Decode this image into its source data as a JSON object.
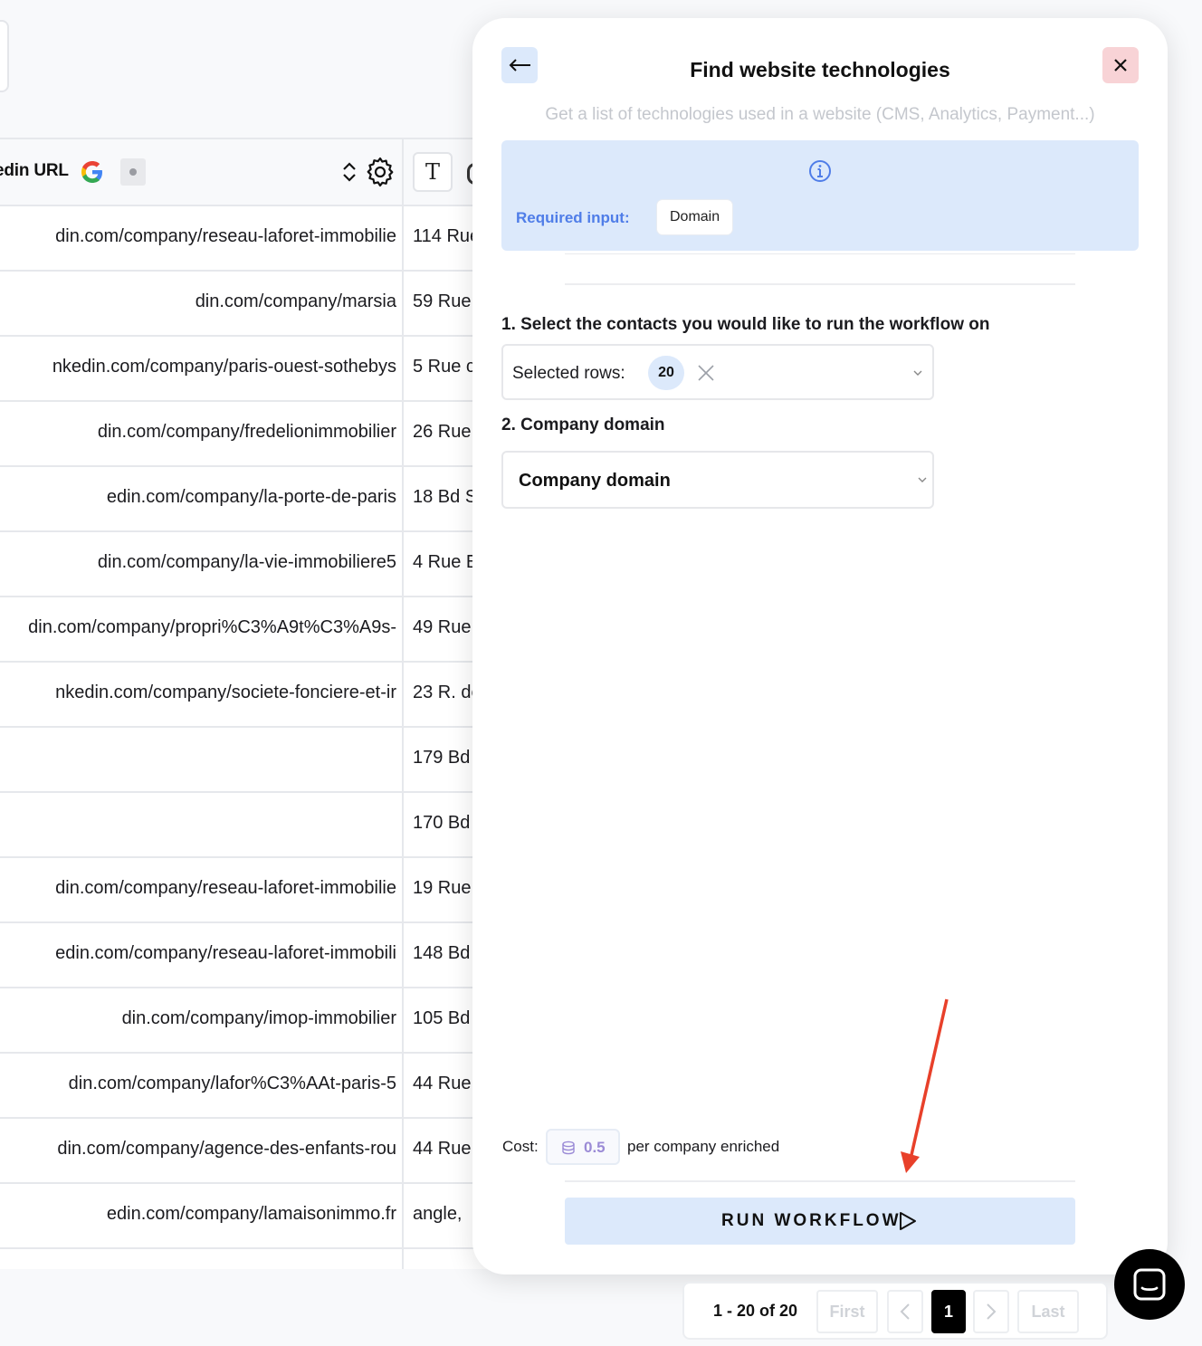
{
  "table": {
    "header": {
      "column_label": "edin URL",
      "google_icon": "google-icon",
      "status_icon": "dot-icon",
      "sort_icon": "sort-icon",
      "settings_icon": "gear-icon",
      "type_icon": "text-type-icon",
      "type_glyph": "T"
    },
    "rows": [
      {
        "url": "din.com/company/reseau-laforet-immobilie",
        "address": "114 Rue"
      },
      {
        "url": "din.com/company/marsia",
        "address": "59 Rue"
      },
      {
        "url": "nkedin.com/company/paris-ouest-sothebys",
        "address": "5 Rue c"
      },
      {
        "url": "din.com/company/fredelionimmobilier",
        "address": "26 Rue"
      },
      {
        "url": "edin.com/company/la-porte-de-paris",
        "address": "18 Bd S"
      },
      {
        "url": "din.com/company/la-vie-immobiliere5",
        "address": "4 Rue E"
      },
      {
        "url": "din.com/company/propri%C3%A9t%C3%A9s-",
        "address": "49 Rue"
      },
      {
        "url": "nkedin.com/company/societe-fonciere-et-ir",
        "address": "23 R. de"
      },
      {
        "url": "",
        "address": "179 Bd"
      },
      {
        "url": "",
        "address": "170 Bd"
      },
      {
        "url": "din.com/company/reseau-laforet-immobilie",
        "address": "19 Rue"
      },
      {
        "url": "edin.com/company/reseau-laforet-immobili",
        "address": "148 Bd"
      },
      {
        "url": "din.com/company/imop-immobilier",
        "address": "105 Bd"
      },
      {
        "url": "din.com/company/lafor%C3%AAt-paris-5",
        "address": "44 Rue"
      },
      {
        "url": "din.com/company/agence-des-enfants-rou",
        "address": "44 Rue"
      },
      {
        "url": "edin.com/company/lamaisonimmo.fr",
        "address": "angle,"
      }
    ]
  },
  "panel": {
    "title": "Find website technologies",
    "subtitle": "Get a list of technologies used in a website (CMS, Analytics, Payment...)",
    "back_icon": "arrow-left-icon",
    "close_icon": "close-icon",
    "info_icon": "info-icon",
    "required_label": "Required input:",
    "required_value": "Domain",
    "step1_label": "1. Select the contacts you would like to run the workflow on",
    "selected_rows_label": "Selected rows:",
    "selected_rows_count": "20",
    "step2_label": "2. Company domain",
    "company_domain_value": "Company domain",
    "cost_label": "Cost:",
    "cost_value": "0.5",
    "cost_suffix": "per company enriched",
    "run_label": "RUN WORKFLOW",
    "accent_color": "#dce9fb",
    "close_color": "#f8d3d6"
  },
  "pager": {
    "count": "1 - 20 of 20",
    "first": "First",
    "page": "1",
    "last": "Last"
  },
  "annotation": {
    "arrow_color": "#e8402a"
  }
}
